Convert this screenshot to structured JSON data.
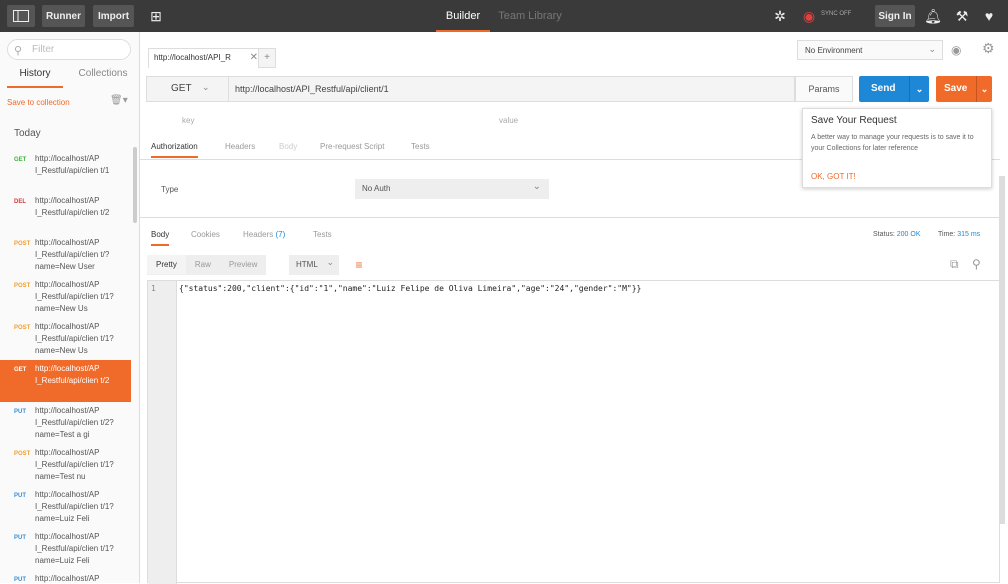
{
  "topbar": {
    "runner_label": "Runner",
    "import_label": "Import",
    "tab_builder": "Builder",
    "tab_team_library": "Team Library",
    "sync_label": "SYNC OFF",
    "sign_in_label": "Sign In"
  },
  "sidebar": {
    "filter_placeholder": "Filter",
    "tab_history": "History",
    "tab_collections": "Collections",
    "save_to_collection": "Save to collection",
    "today_label": "Today",
    "items": [
      {
        "method": "GET",
        "color": "#3cb43c",
        "url": "http://localhost/AP I_Restful/api/clien t/1"
      },
      {
        "method": "DEL",
        "color": "#d73c3c",
        "url": "http://localhost/AP I_Restful/api/clien t/2"
      },
      {
        "method": "POST",
        "color": "#f0a030",
        "url": "http://localhost/AP I_Restful/api/clien t/?name=New User"
      },
      {
        "method": "POST",
        "color": "#f0a030",
        "url": "http://localhost/AP I_Restful/api/clien t/1?name=New Us"
      },
      {
        "method": "POST",
        "color": "#f0a030",
        "url": "http://localhost/AP I_Restful/api/clien t/1?name=New Us"
      },
      {
        "method": "GET",
        "color": "#ffffff",
        "url": "http://localhost/AP I_Restful/api/clien t/2"
      },
      {
        "method": "PUT",
        "color": "#3c8fd7",
        "url": "http://localhost/AP I_Restful/api/clien t/2?name=Test a gi"
      },
      {
        "method": "POST",
        "color": "#f0a030",
        "url": "http://localhost/AP I_Restful/api/clien t/1?name=Test nu"
      },
      {
        "method": "PUT",
        "color": "#3c8fd7",
        "url": "http://localhost/AP I_Restful/api/clien t/1?name=Luiz Feli"
      },
      {
        "method": "PUT",
        "color": "#3c8fd7",
        "url": "http://localhost/AP I_Restful/api/clien t/1?name=Luiz Feli"
      },
      {
        "method": "PUT",
        "color": "#3c8fd7",
        "url": "http://localhost/AP"
      }
    ]
  },
  "request": {
    "tab_label": "http://localhost/API_R",
    "environment": "No Environment",
    "method": "GET",
    "url": "http://localhost/API_Restful/api/client/1",
    "params_label": "Params",
    "send_label": "Send",
    "save_label": "Save",
    "key_placeholder": "key",
    "value_placeholder": "value",
    "tabs": [
      "Authorization",
      "Headers",
      "Body",
      "Pre-request Script",
      "Tests"
    ],
    "type_label": "Type",
    "auth_value": "No Auth"
  },
  "response": {
    "tabs": [
      "Body",
      "Cookies",
      "Headers",
      "Tests"
    ],
    "headers_count": "(7)",
    "status_label": "Status:",
    "status_value": "200 OK",
    "time_label": "Time:",
    "time_value": "315 ms",
    "formats": [
      "Pretty",
      "Raw",
      "Preview"
    ],
    "language": "HTML",
    "line_number": "1",
    "body": "{\"status\":200,\"client\":{\"id\":\"1\",\"name\":\"Luiz Felipe de Oliva Limeira\",\"age\":\"24\",\"gender\":\"M\"}}"
  },
  "tooltip": {
    "title": "Save Your Request",
    "text": "A better way to manage your requests is to save it to your Collections for later reference",
    "action": "OK, GOT IT!"
  },
  "colors": {
    "accent": "#f06a29",
    "send_blue": "#1e88d6",
    "topbar_bg": "#3a3a3a"
  }
}
